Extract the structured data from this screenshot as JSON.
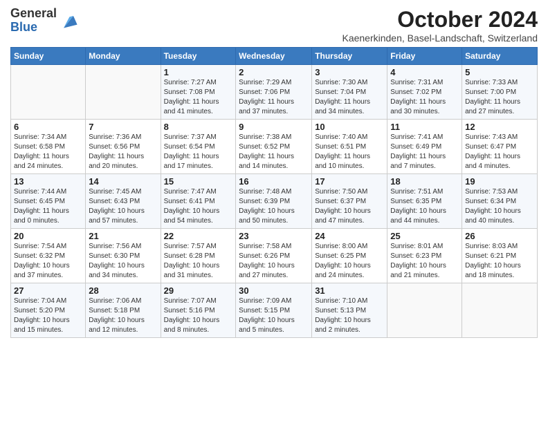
{
  "header": {
    "logo_general": "General",
    "logo_blue": "Blue",
    "month_title": "October 2024",
    "subtitle": "Kaenerkinden, Basel-Landschaft, Switzerland"
  },
  "weekdays": [
    "Sunday",
    "Monday",
    "Tuesday",
    "Wednesday",
    "Thursday",
    "Friday",
    "Saturday"
  ],
  "weeks": [
    [
      {
        "day": "",
        "info": ""
      },
      {
        "day": "",
        "info": ""
      },
      {
        "day": "1",
        "info": "Sunrise: 7:27 AM\nSunset: 7:08 PM\nDaylight: 11 hours\nand 41 minutes."
      },
      {
        "day": "2",
        "info": "Sunrise: 7:29 AM\nSunset: 7:06 PM\nDaylight: 11 hours\nand 37 minutes."
      },
      {
        "day": "3",
        "info": "Sunrise: 7:30 AM\nSunset: 7:04 PM\nDaylight: 11 hours\nand 34 minutes."
      },
      {
        "day": "4",
        "info": "Sunrise: 7:31 AM\nSunset: 7:02 PM\nDaylight: 11 hours\nand 30 minutes."
      },
      {
        "day": "5",
        "info": "Sunrise: 7:33 AM\nSunset: 7:00 PM\nDaylight: 11 hours\nand 27 minutes."
      }
    ],
    [
      {
        "day": "6",
        "info": "Sunrise: 7:34 AM\nSunset: 6:58 PM\nDaylight: 11 hours\nand 24 minutes."
      },
      {
        "day": "7",
        "info": "Sunrise: 7:36 AM\nSunset: 6:56 PM\nDaylight: 11 hours\nand 20 minutes."
      },
      {
        "day": "8",
        "info": "Sunrise: 7:37 AM\nSunset: 6:54 PM\nDaylight: 11 hours\nand 17 minutes."
      },
      {
        "day": "9",
        "info": "Sunrise: 7:38 AM\nSunset: 6:52 PM\nDaylight: 11 hours\nand 14 minutes."
      },
      {
        "day": "10",
        "info": "Sunrise: 7:40 AM\nSunset: 6:51 PM\nDaylight: 11 hours\nand 10 minutes."
      },
      {
        "day": "11",
        "info": "Sunrise: 7:41 AM\nSunset: 6:49 PM\nDaylight: 11 hours\nand 7 minutes."
      },
      {
        "day": "12",
        "info": "Sunrise: 7:43 AM\nSunset: 6:47 PM\nDaylight: 11 hours\nand 4 minutes."
      }
    ],
    [
      {
        "day": "13",
        "info": "Sunrise: 7:44 AM\nSunset: 6:45 PM\nDaylight: 11 hours\nand 0 minutes."
      },
      {
        "day": "14",
        "info": "Sunrise: 7:45 AM\nSunset: 6:43 PM\nDaylight: 10 hours\nand 57 minutes."
      },
      {
        "day": "15",
        "info": "Sunrise: 7:47 AM\nSunset: 6:41 PM\nDaylight: 10 hours\nand 54 minutes."
      },
      {
        "day": "16",
        "info": "Sunrise: 7:48 AM\nSunset: 6:39 PM\nDaylight: 10 hours\nand 50 minutes."
      },
      {
        "day": "17",
        "info": "Sunrise: 7:50 AM\nSunset: 6:37 PM\nDaylight: 10 hours\nand 47 minutes."
      },
      {
        "day": "18",
        "info": "Sunrise: 7:51 AM\nSunset: 6:35 PM\nDaylight: 10 hours\nand 44 minutes."
      },
      {
        "day": "19",
        "info": "Sunrise: 7:53 AM\nSunset: 6:34 PM\nDaylight: 10 hours\nand 40 minutes."
      }
    ],
    [
      {
        "day": "20",
        "info": "Sunrise: 7:54 AM\nSunset: 6:32 PM\nDaylight: 10 hours\nand 37 minutes."
      },
      {
        "day": "21",
        "info": "Sunrise: 7:56 AM\nSunset: 6:30 PM\nDaylight: 10 hours\nand 34 minutes."
      },
      {
        "day": "22",
        "info": "Sunrise: 7:57 AM\nSunset: 6:28 PM\nDaylight: 10 hours\nand 31 minutes."
      },
      {
        "day": "23",
        "info": "Sunrise: 7:58 AM\nSunset: 6:26 PM\nDaylight: 10 hours\nand 27 minutes."
      },
      {
        "day": "24",
        "info": "Sunrise: 8:00 AM\nSunset: 6:25 PM\nDaylight: 10 hours\nand 24 minutes."
      },
      {
        "day": "25",
        "info": "Sunrise: 8:01 AM\nSunset: 6:23 PM\nDaylight: 10 hours\nand 21 minutes."
      },
      {
        "day": "26",
        "info": "Sunrise: 8:03 AM\nSunset: 6:21 PM\nDaylight: 10 hours\nand 18 minutes."
      }
    ],
    [
      {
        "day": "27",
        "info": "Sunrise: 7:04 AM\nSunset: 5:20 PM\nDaylight: 10 hours\nand 15 minutes."
      },
      {
        "day": "28",
        "info": "Sunrise: 7:06 AM\nSunset: 5:18 PM\nDaylight: 10 hours\nand 12 minutes."
      },
      {
        "day": "29",
        "info": "Sunrise: 7:07 AM\nSunset: 5:16 PM\nDaylight: 10 hours\nand 8 minutes."
      },
      {
        "day": "30",
        "info": "Sunrise: 7:09 AM\nSunset: 5:15 PM\nDaylight: 10 hours\nand 5 minutes."
      },
      {
        "day": "31",
        "info": "Sunrise: 7:10 AM\nSunset: 5:13 PM\nDaylight: 10 hours\nand 2 minutes."
      },
      {
        "day": "",
        "info": ""
      },
      {
        "day": "",
        "info": ""
      }
    ]
  ]
}
